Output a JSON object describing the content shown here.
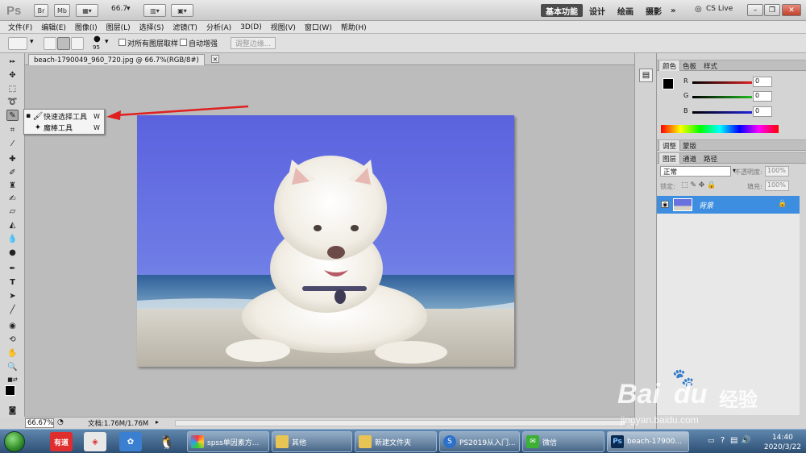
{
  "app": {
    "logo": "Ps",
    "top_buttons": [
      "Br",
      "Mb"
    ],
    "zoom_value": "66.7",
    "workspaces": [
      "基本功能",
      "设计",
      "绘画",
      "摄影"
    ],
    "more": "»",
    "cs_live": "CS Live"
  },
  "menu": [
    "文件(F)",
    "编辑(E)",
    "图像(I)",
    "图层(L)",
    "选择(S)",
    "滤镜(T)",
    "分析(A)",
    "3D(D)",
    "视图(V)",
    "窗口(W)",
    "帮助(H)"
  ],
  "options": {
    "brush_size": "95",
    "sample_all_layers": "对所有图层取样",
    "auto_enhance": "自动增强",
    "refine_edge": "调整边缘..."
  },
  "document": {
    "tab_title": "beach-1790049_960_720.jpg @ 66.7%(RGB/8#)"
  },
  "flyout": {
    "items": [
      {
        "label": "快速选择工具",
        "shortcut": "W",
        "selected": true
      },
      {
        "label": "魔棒工具",
        "shortcut": "W",
        "selected": false
      }
    ]
  },
  "status": {
    "zoom": "66.67%",
    "doc_info": "文档:1.76M/1.76M"
  },
  "color_panel": {
    "tabs": [
      "颜色",
      "色板",
      "样式"
    ],
    "channels": [
      {
        "name": "R",
        "value": "0",
        "color": "#cc2020"
      },
      {
        "name": "G",
        "value": "0",
        "color": "#20a020"
      },
      {
        "name": "B",
        "value": "0",
        "color": "#2020cc"
      }
    ]
  },
  "adjust_panel": {
    "tabs": [
      "调整",
      "蒙版"
    ]
  },
  "layers_panel": {
    "tabs": [
      "图层",
      "通道",
      "路径"
    ],
    "blend_mode": "正常",
    "opacity_label": "不透明度:",
    "opacity_value": "100%",
    "lock_label": "锁定:",
    "fill_label": "填充:",
    "fill_value": "100%",
    "layer_name": "背景"
  },
  "taskbar": {
    "pins": [
      "有道"
    ],
    "tasks": [
      "spss单因素方...",
      "其他",
      "新建文件夹",
      "PS2019从入门...",
      "微信",
      "beach-17900..."
    ],
    "time": "14:40",
    "date": "2020/3/22"
  },
  "watermark": {
    "brand": "Bai",
    "brand2": "du",
    "jingyan": "经验",
    "url": "jingyan.baidu.com"
  },
  "colors": {
    "layer_selected": "#3d8ee0",
    "arrow": "#e02020",
    "sky": "#6670e0"
  }
}
